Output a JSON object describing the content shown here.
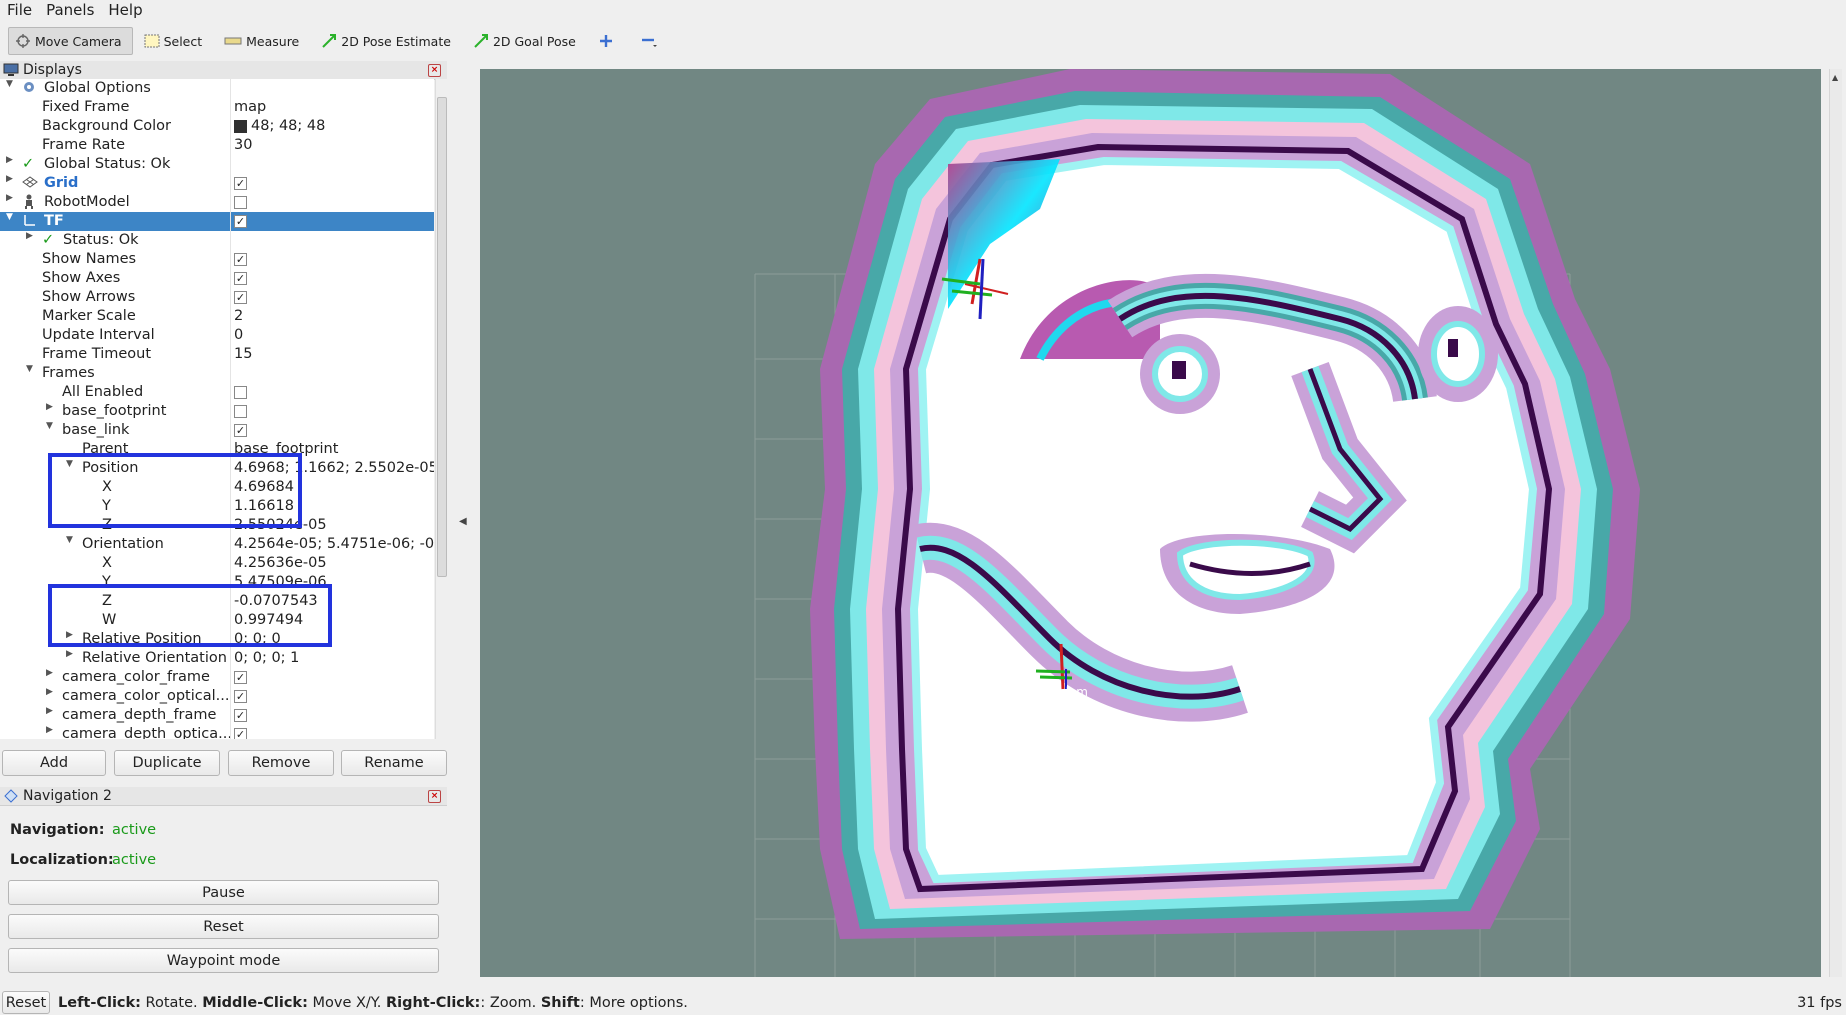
{
  "menu": {
    "file": "File",
    "panels": "Panels",
    "help": "Help"
  },
  "toolbar": {
    "move_camera": "Move Camera",
    "select": "Select",
    "measure": "Measure",
    "pose_estimate": "2D Pose Estimate",
    "goal_pose": "2D Goal Pose"
  },
  "displays_panel": {
    "title": "Displays",
    "global_options": "Global Options",
    "fixed_frame_label": "Fixed Frame",
    "fixed_frame_value": "map",
    "bg_color_label": "Background Color",
    "bg_color_value": "48; 48; 48",
    "frame_rate_label": "Frame Rate",
    "frame_rate_value": "30",
    "global_status": "Global Status: Ok",
    "grid": "Grid",
    "robot_model": "RobotModel",
    "tf": "TF",
    "tf_status": "Status: Ok",
    "show_names": "Show Names",
    "show_axes": "Show Axes",
    "show_arrows": "Show Arrows",
    "marker_scale_label": "Marker Scale",
    "marker_scale_value": "2",
    "update_interval_label": "Update Interval",
    "update_interval_value": "0",
    "frame_timeout_label": "Frame Timeout",
    "frame_timeout_value": "15",
    "frames": "Frames",
    "all_enabled": "All Enabled",
    "base_footprint": "base_footprint",
    "base_link": "base_link",
    "parent_label": "Parent",
    "parent_value": "base_footprint",
    "position_label": "Position",
    "position_value": "4.6968; 1.1662; 2.5502e-05",
    "pos_x_label": "X",
    "pos_x_value": "4.69684",
    "pos_y_label": "Y",
    "pos_y_value": "1.16618",
    "pos_z_label": "Z",
    "pos_z_value": "2.55024e-05",
    "orientation_label": "Orientation",
    "orientation_value": "4.2564e-05; 5.4751e-06; -0.0...",
    "ori_x_label": "X",
    "ori_x_value": "4.25636e-05",
    "ori_y_label": "Y",
    "ori_y_value": "5.47509e-06",
    "ori_z_label": "Z",
    "ori_z_value": "-0.0707543",
    "ori_w_label": "W",
    "ori_w_value": "0.997494",
    "rel_position_label": "Relative Position",
    "rel_position_value": "0; 0; 0",
    "rel_orientation_label": "Relative Orientation",
    "rel_orientation_value": "0; 0; 0; 1",
    "camera_color_frame": "camera_color_frame",
    "camera_color_optical": "camera_color_optical...",
    "camera_depth_frame": "camera_depth_frame",
    "camera_depth_optical": "camera_depth_optica..."
  },
  "panel_buttons": {
    "add": "Add",
    "duplicate": "Duplicate",
    "remove": "Remove",
    "rename": "Rename"
  },
  "navigation_panel": {
    "title": "Navigation 2",
    "navigation_label": "Navigation:",
    "navigation_value": "active",
    "localization_label": "Localization:",
    "localization_value": "active",
    "pause": "Pause",
    "reset": "Reset",
    "waypoint_mode": "Waypoint mode"
  },
  "viewport": {
    "frame_label": "odom"
  },
  "status": {
    "reset": "Reset",
    "left_click_label": "Left-Click:",
    "left_click_text": " Rotate. ",
    "middle_click_label": "Middle-Click:",
    "middle_click_text": " Move X/Y. ",
    "right_click_label": "Right-Click:",
    "right_click_text": ": Zoom. ",
    "shift_label": "Shift",
    "shift_text": ": More options.",
    "fps": "31 fps"
  },
  "colors": {
    "selection": "#3d85c6",
    "highlight_box": "#2233dd",
    "active_green": "#1a9a1a",
    "viewport_bg": "#718783"
  }
}
